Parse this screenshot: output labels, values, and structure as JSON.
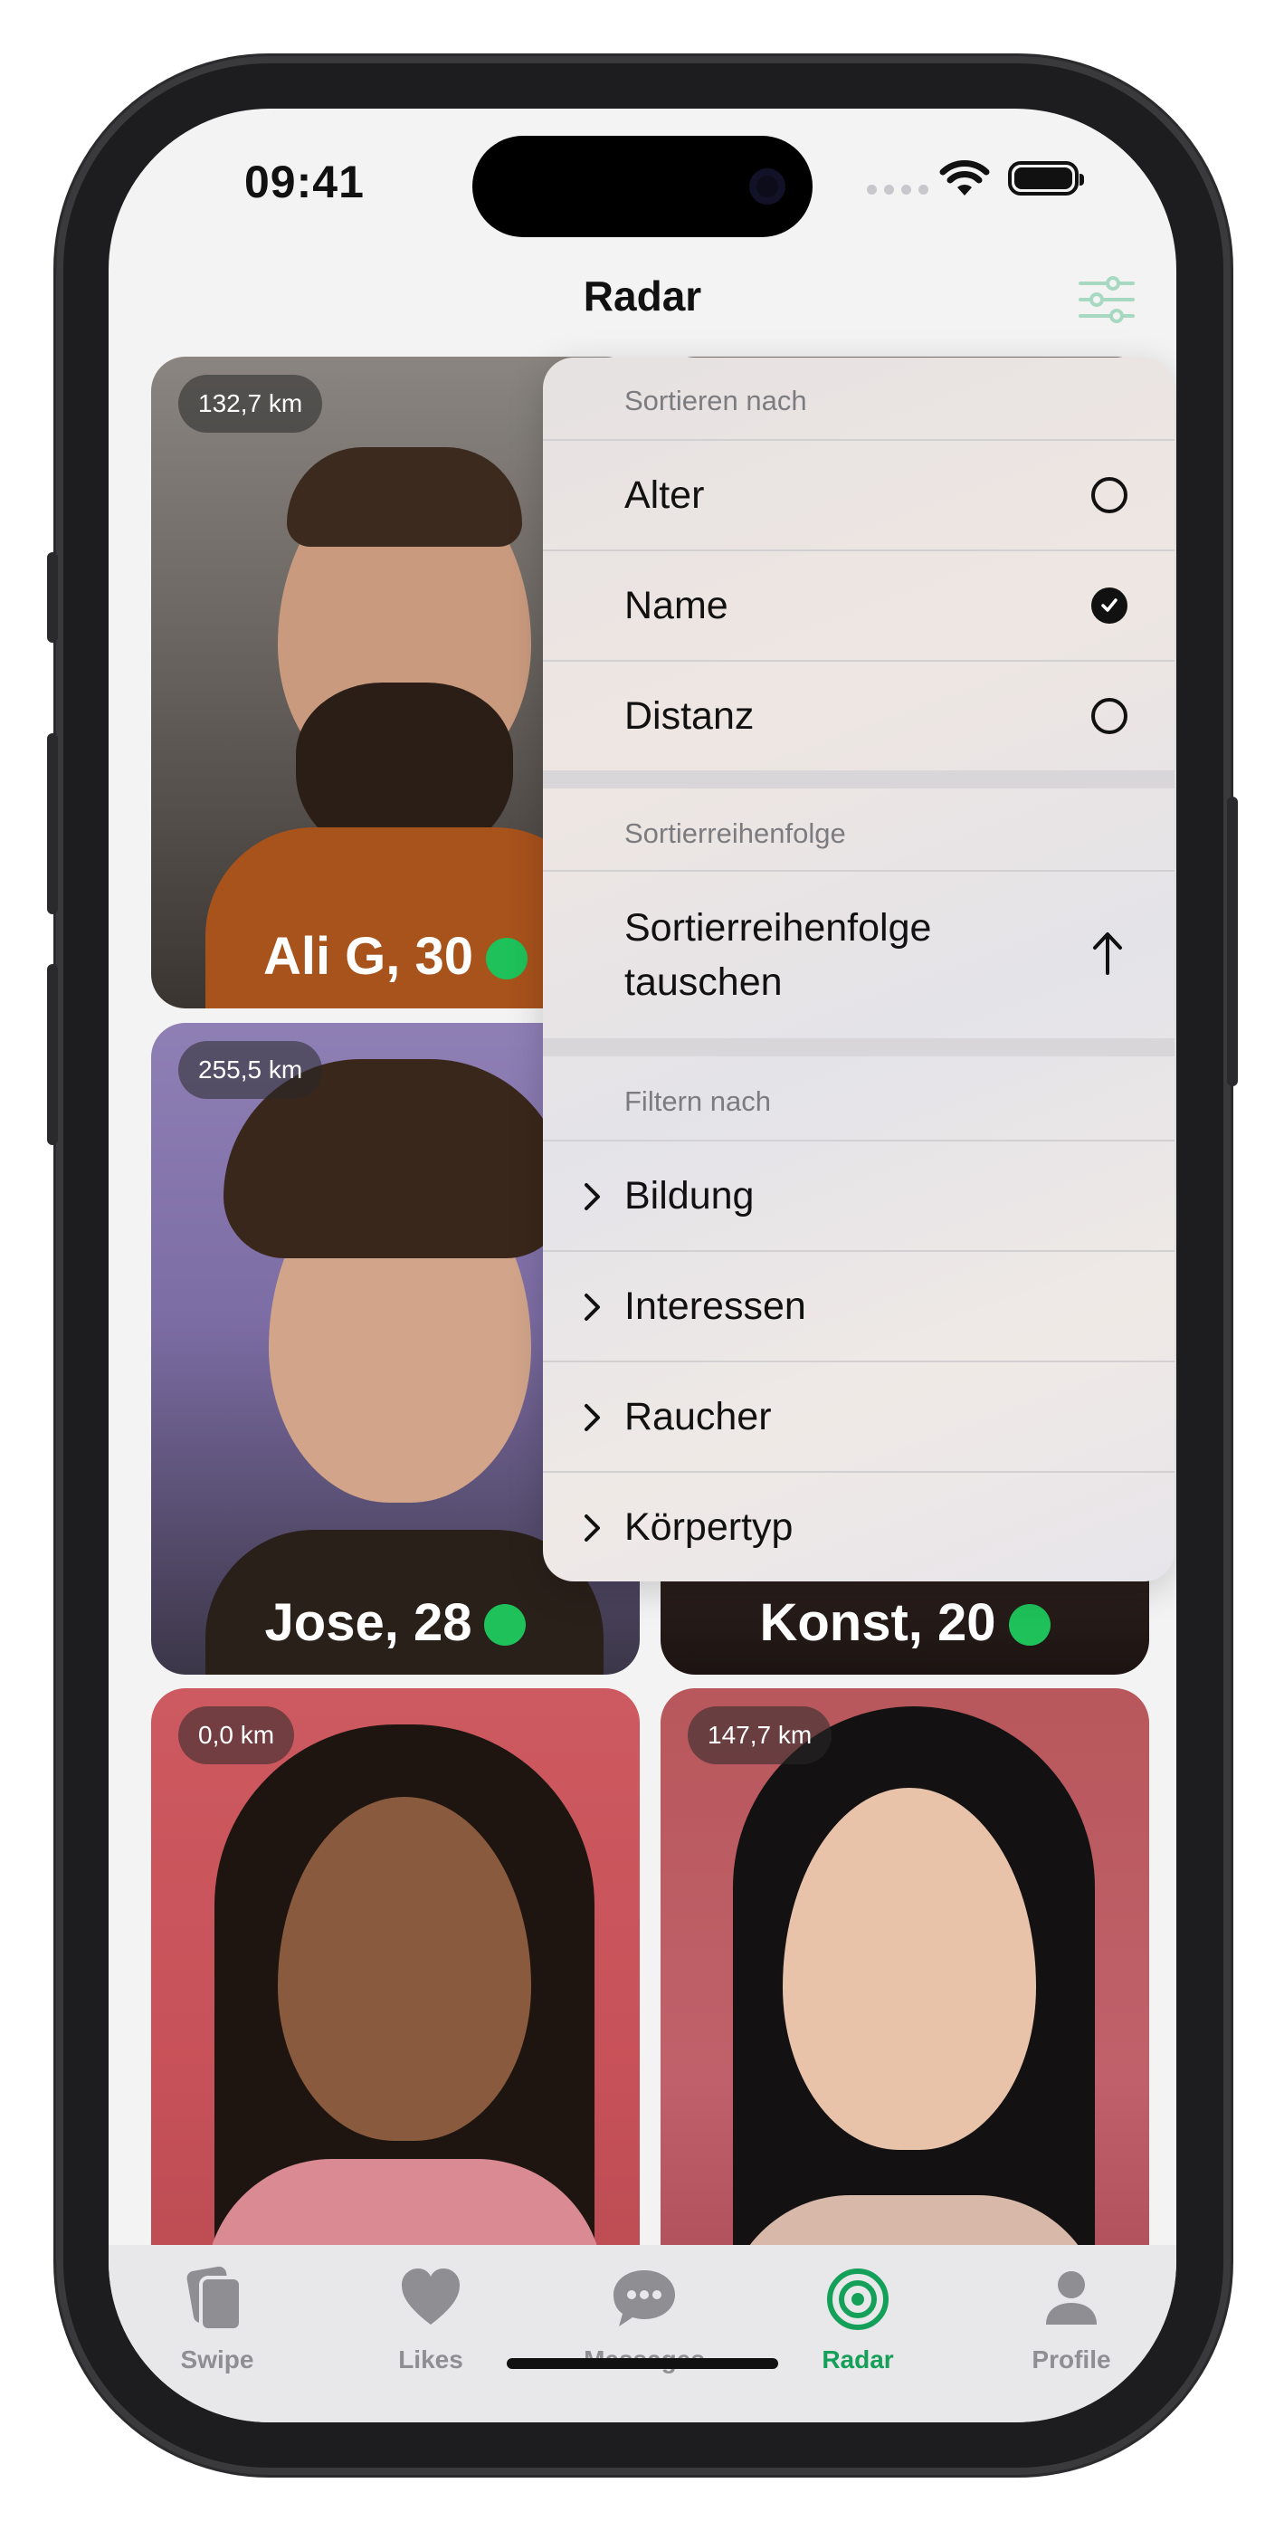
{
  "status": {
    "time": "09:41"
  },
  "nav": {
    "title": "Radar"
  },
  "profiles": [
    {
      "name": "Ali G, 30",
      "distance": "132,7 km",
      "online": true
    },
    {
      "name": "Jose, 28",
      "distance": "255,5 km",
      "online": true
    },
    {
      "name": "Konst, 20",
      "distance": "",
      "online": true
    },
    {
      "name": "",
      "distance": "0,0 km",
      "online": false
    },
    {
      "name": "",
      "distance": "147,7 km",
      "online": false
    }
  ],
  "menu": {
    "sort_header": "Sortieren nach",
    "sort_options": [
      {
        "label": "Alter",
        "selected": false
      },
      {
        "label": "Name",
        "selected": true
      },
      {
        "label": "Distanz",
        "selected": false
      }
    ],
    "order_header": "Sortierreihenfolge",
    "order_toggle_line1": "Sortierreihenfolge",
    "order_toggle_line2": "tauschen",
    "filter_header": "Filtern nach",
    "filters": [
      "Bildung",
      "Interessen",
      "Raucher",
      "Körpertyp"
    ]
  },
  "tabs": [
    {
      "label": "Swipe",
      "icon": "cards-icon",
      "active": false
    },
    {
      "label": "Likes",
      "icon": "heart-icon",
      "active": false
    },
    {
      "label": "Messages",
      "icon": "chat-bubble-icon",
      "active": false
    },
    {
      "label": "Radar",
      "icon": "radar-icon",
      "active": true
    },
    {
      "label": "Profile",
      "icon": "person-icon",
      "active": false
    }
  ],
  "colors": {
    "accent": "#15a05a",
    "online": "#1ec15a"
  }
}
